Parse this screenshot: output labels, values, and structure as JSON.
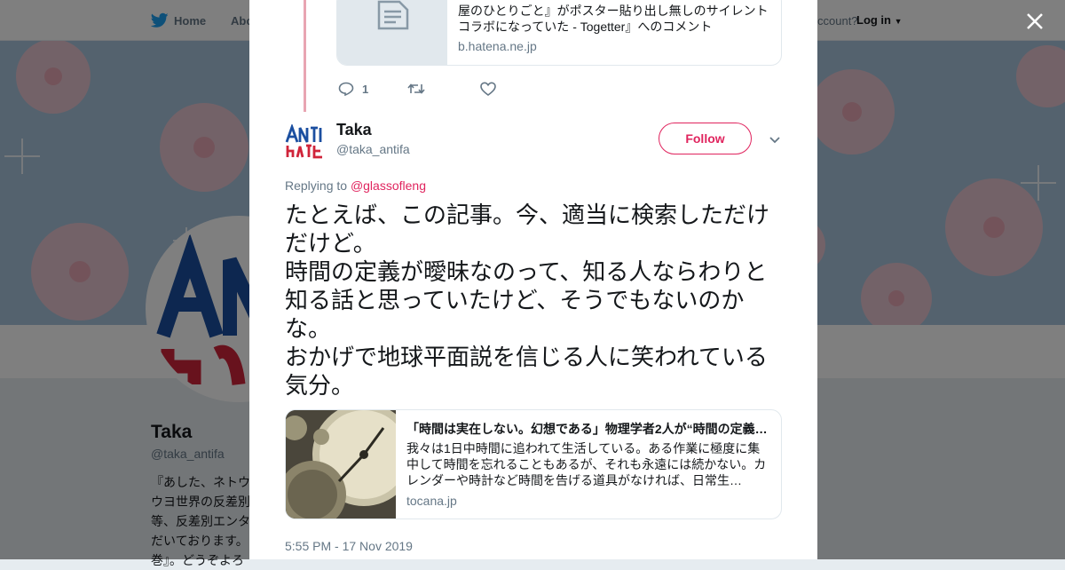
{
  "nav": {
    "home_label": "Home",
    "about_label": "Abo",
    "account_text": "ccount?",
    "login_label": "Log in"
  },
  "profile": {
    "name": "Taka",
    "handle": "@taka_antifa",
    "bio": "『あした、ネトウ\nウヨ世界の反差別\n等、反差別エンタ\nだいております。\n巻』。どうぞよろ"
  },
  "modal": {
    "quoted_card": {
      "title": "屋のひとりごと』がポスター貼り出し無しのサイレントコラボになっていた - Togetter』へのコメント",
      "domain": "b.hatena.ne.jp"
    },
    "parent_actions": {
      "reply_count": "1"
    },
    "tweet": {
      "author_name": "Taka",
      "author_handle": "@taka_antifa",
      "follow_label": "Follow",
      "replying_prefix": "Replying to ",
      "replying_to": "@glassofleng",
      "text": "たとえば、この記事。今、適当に検索しただけだけど。\n時間の定義が曖昧なのって、知る人ならわりと知る話と思っていたけど、そうでもないのかな。\nおかげで地球平面説を信じる人に笑われている気分。",
      "card": {
        "title": "「時間は実在しない。幻想である」物理学者2人が“時間の定義…",
        "description": "我々は1日中時間に追われて生活している。ある作業に極度に集中して時間を忘れることもあるが、それも永遠には続かない。カレンダーや時計など時間を告げる道具がなければ、日常生…",
        "domain": "tocana.jp"
      },
      "timestamp": "5:55 PM - 17 Nov 2019"
    }
  },
  "colors": {
    "accent": "#e0245e",
    "twitter_blue": "#1da1f2",
    "secondary_text": "#657786",
    "thread_line": "#e8a5b2",
    "banner_blue": "#a9c4dd"
  },
  "icons": [
    "twitter-bird-icon",
    "close-icon",
    "document-icon",
    "reply-icon",
    "retweet-icon",
    "like-icon",
    "chevron-down-icon"
  ]
}
